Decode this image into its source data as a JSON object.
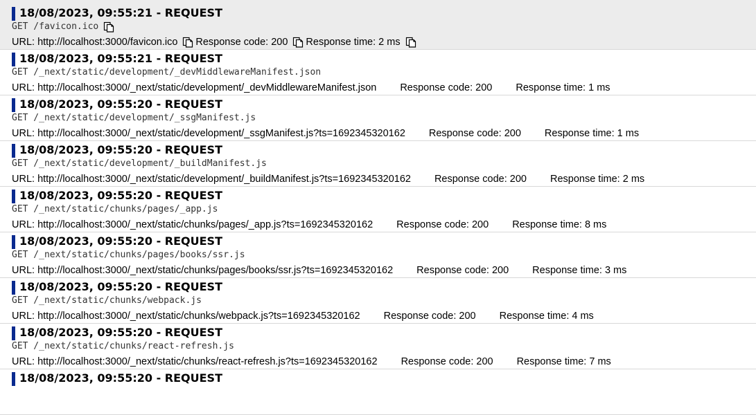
{
  "entries": [
    {
      "title": "18/08/2023, 09:55:21 - REQUEST",
      "request": "GET /favicon.ico",
      "url": "URL: http://localhost:3000/favicon.ico",
      "code": "Response code: 200",
      "time": "Response time: 2 ms",
      "selected": true
    },
    {
      "title": "18/08/2023, 09:55:21 - REQUEST",
      "request": "GET /_next/static/development/_devMiddlewareManifest.json",
      "url": "URL: http://localhost:3000/_next/static/development/_devMiddlewareManifest.json",
      "code": "Response code: 200",
      "time": "Response time: 1 ms"
    },
    {
      "title": "18/08/2023, 09:55:20 - REQUEST",
      "request": "GET /_next/static/development/_ssgManifest.js",
      "url": "URL: http://localhost:3000/_next/static/development/_ssgManifest.js?ts=1692345320162",
      "code": "Response code: 200",
      "time": "Response time: 1 ms"
    },
    {
      "title": "18/08/2023, 09:55:20 - REQUEST",
      "request": "GET /_next/static/development/_buildManifest.js",
      "url": "URL: http://localhost:3000/_next/static/development/_buildManifest.js?ts=1692345320162",
      "code": "Response code: 200",
      "time": "Response time: 2 ms"
    },
    {
      "title": "18/08/2023, 09:55:20 - REQUEST",
      "request": "GET /_next/static/chunks/pages/_app.js",
      "url": "URL: http://localhost:3000/_next/static/chunks/pages/_app.js?ts=1692345320162",
      "code": "Response code: 200",
      "time": "Response time: 8 ms"
    },
    {
      "title": "18/08/2023, 09:55:20 - REQUEST",
      "request": "GET /_next/static/chunks/pages/books/ssr.js",
      "url": "URL: http://localhost:3000/_next/static/chunks/pages/books/ssr.js?ts=1692345320162",
      "code": "Response code: 200",
      "time": "Response time: 3 ms"
    },
    {
      "title": "18/08/2023, 09:55:20 - REQUEST",
      "request": "GET /_next/static/chunks/webpack.js",
      "url": "URL: http://localhost:3000/_next/static/chunks/webpack.js?ts=1692345320162",
      "code": "Response code: 200",
      "time": "Response time: 4 ms"
    },
    {
      "title": "18/08/2023, 09:55:20 - REQUEST",
      "request": "GET /_next/static/chunks/react-refresh.js",
      "url": "URL: http://localhost:3000/_next/static/chunks/react-refresh.js?ts=1692345320162",
      "code": "Response code: 200",
      "time": "Response time: 7 ms"
    },
    {
      "title": "18/08/2023, 09:55:20 - REQUEST",
      "request": "",
      "url": "",
      "code": "",
      "time": ""
    }
  ],
  "colors": {
    "marker": "#0a2a8f",
    "selected_bg": "#ececec",
    "divider": "#d8d8d8"
  },
  "icons": {
    "copy": "copy-icon"
  }
}
